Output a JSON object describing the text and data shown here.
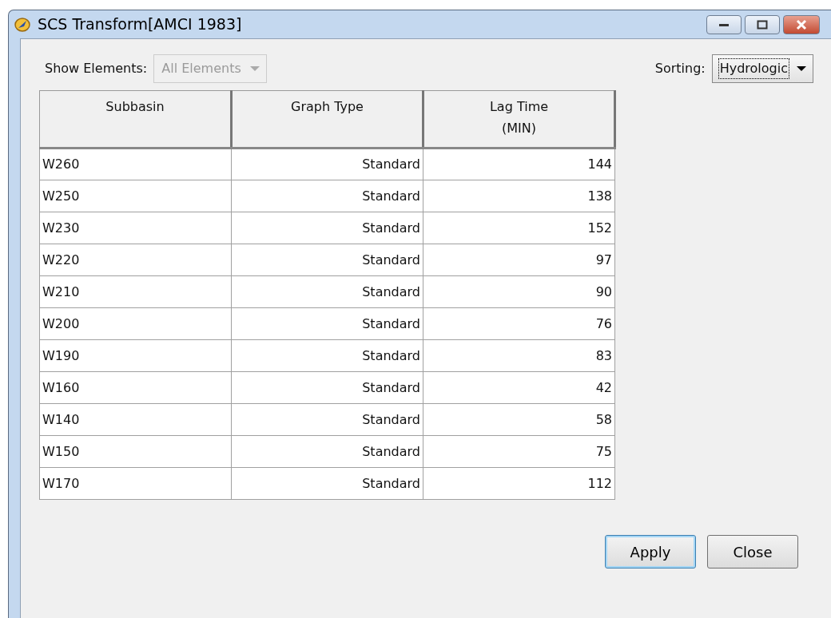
{
  "window": {
    "title": "SCS Transform[AMCI 1983]"
  },
  "filters": [
    {
      "label": "Show Elements:",
      "value": "All Elements",
      "disabled": true
    },
    {
      "label": "Sorting:",
      "value": "Hydrologic",
      "disabled": false
    }
  ],
  "table": {
    "columns": [
      {
        "label": "Subbasin",
        "kind": "text"
      },
      {
        "label": "Graph Type",
        "kind": "number"
      },
      {
        "label": "Lag Time",
        "unit": "(MIN)",
        "kind": "number"
      }
    ],
    "rows": [
      [
        "W260",
        "Standard",
        "144"
      ],
      [
        "W250",
        "Standard",
        "138"
      ],
      [
        "W230",
        "Standard",
        "152"
      ],
      [
        "W220",
        "Standard",
        "97"
      ],
      [
        "W210",
        "Standard",
        "90"
      ],
      [
        "W200",
        "Standard",
        "76"
      ],
      [
        "W190",
        "Standard",
        "83"
      ],
      [
        "W160",
        "Standard",
        "42"
      ],
      [
        "W140",
        "Standard",
        "58"
      ],
      [
        "W150",
        "Standard",
        "75"
      ],
      [
        "W170",
        "Standard",
        "112"
      ]
    ]
  },
  "buttons": [
    {
      "label": "Apply",
      "default": true
    },
    {
      "label": "Close",
      "default": false
    }
  ]
}
